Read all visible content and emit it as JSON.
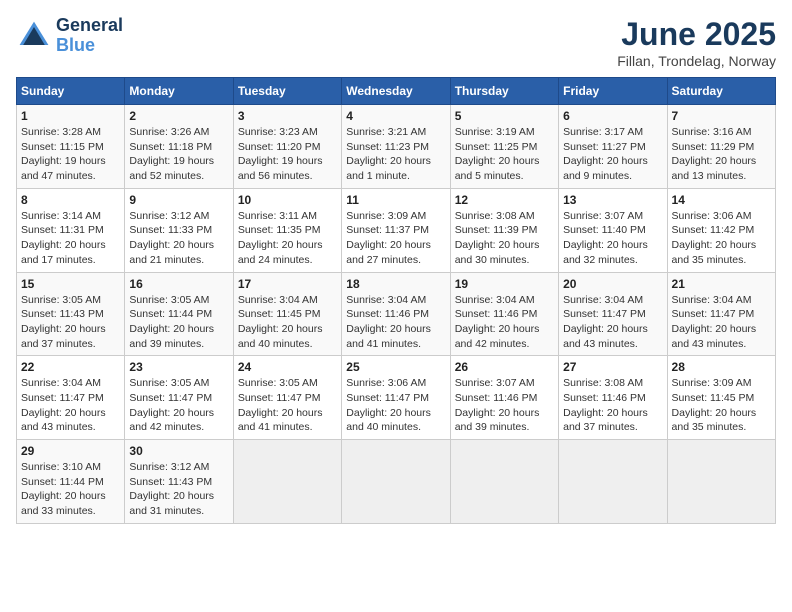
{
  "logo": {
    "line1": "General",
    "line2": "Blue"
  },
  "title": "June 2025",
  "subtitle": "Fillan, Trondelag, Norway",
  "days_header": [
    "Sunday",
    "Monday",
    "Tuesday",
    "Wednesday",
    "Thursday",
    "Friday",
    "Saturday"
  ],
  "weeks": [
    [
      {
        "day": 1,
        "info": "Sunrise: 3:28 AM\nSunset: 11:15 PM\nDaylight: 19 hours\nand 47 minutes."
      },
      {
        "day": 2,
        "info": "Sunrise: 3:26 AM\nSunset: 11:18 PM\nDaylight: 19 hours\nand 52 minutes."
      },
      {
        "day": 3,
        "info": "Sunrise: 3:23 AM\nSunset: 11:20 PM\nDaylight: 19 hours\nand 56 minutes."
      },
      {
        "day": 4,
        "info": "Sunrise: 3:21 AM\nSunset: 11:23 PM\nDaylight: 20 hours\nand 1 minute."
      },
      {
        "day": 5,
        "info": "Sunrise: 3:19 AM\nSunset: 11:25 PM\nDaylight: 20 hours\nand 5 minutes."
      },
      {
        "day": 6,
        "info": "Sunrise: 3:17 AM\nSunset: 11:27 PM\nDaylight: 20 hours\nand 9 minutes."
      },
      {
        "day": 7,
        "info": "Sunrise: 3:16 AM\nSunset: 11:29 PM\nDaylight: 20 hours\nand 13 minutes."
      }
    ],
    [
      {
        "day": 8,
        "info": "Sunrise: 3:14 AM\nSunset: 11:31 PM\nDaylight: 20 hours\nand 17 minutes."
      },
      {
        "day": 9,
        "info": "Sunrise: 3:12 AM\nSunset: 11:33 PM\nDaylight: 20 hours\nand 21 minutes."
      },
      {
        "day": 10,
        "info": "Sunrise: 3:11 AM\nSunset: 11:35 PM\nDaylight: 20 hours\nand 24 minutes."
      },
      {
        "day": 11,
        "info": "Sunrise: 3:09 AM\nSunset: 11:37 PM\nDaylight: 20 hours\nand 27 minutes."
      },
      {
        "day": 12,
        "info": "Sunrise: 3:08 AM\nSunset: 11:39 PM\nDaylight: 20 hours\nand 30 minutes."
      },
      {
        "day": 13,
        "info": "Sunrise: 3:07 AM\nSunset: 11:40 PM\nDaylight: 20 hours\nand 32 minutes."
      },
      {
        "day": 14,
        "info": "Sunrise: 3:06 AM\nSunset: 11:42 PM\nDaylight: 20 hours\nand 35 minutes."
      }
    ],
    [
      {
        "day": 15,
        "info": "Sunrise: 3:05 AM\nSunset: 11:43 PM\nDaylight: 20 hours\nand 37 minutes."
      },
      {
        "day": 16,
        "info": "Sunrise: 3:05 AM\nSunset: 11:44 PM\nDaylight: 20 hours\nand 39 minutes."
      },
      {
        "day": 17,
        "info": "Sunrise: 3:04 AM\nSunset: 11:45 PM\nDaylight: 20 hours\nand 40 minutes."
      },
      {
        "day": 18,
        "info": "Sunrise: 3:04 AM\nSunset: 11:46 PM\nDaylight: 20 hours\nand 41 minutes."
      },
      {
        "day": 19,
        "info": "Sunrise: 3:04 AM\nSunset: 11:46 PM\nDaylight: 20 hours\nand 42 minutes."
      },
      {
        "day": 20,
        "info": "Sunrise: 3:04 AM\nSunset: 11:47 PM\nDaylight: 20 hours\nand 43 minutes."
      },
      {
        "day": 21,
        "info": "Sunrise: 3:04 AM\nSunset: 11:47 PM\nDaylight: 20 hours\nand 43 minutes."
      }
    ],
    [
      {
        "day": 22,
        "info": "Sunrise: 3:04 AM\nSunset: 11:47 PM\nDaylight: 20 hours\nand 43 minutes."
      },
      {
        "day": 23,
        "info": "Sunrise: 3:05 AM\nSunset: 11:47 PM\nDaylight: 20 hours\nand 42 minutes."
      },
      {
        "day": 24,
        "info": "Sunrise: 3:05 AM\nSunset: 11:47 PM\nDaylight: 20 hours\nand 41 minutes."
      },
      {
        "day": 25,
        "info": "Sunrise: 3:06 AM\nSunset: 11:47 PM\nDaylight: 20 hours\nand 40 minutes."
      },
      {
        "day": 26,
        "info": "Sunrise: 3:07 AM\nSunset: 11:46 PM\nDaylight: 20 hours\nand 39 minutes."
      },
      {
        "day": 27,
        "info": "Sunrise: 3:08 AM\nSunset: 11:46 PM\nDaylight: 20 hours\nand 37 minutes."
      },
      {
        "day": 28,
        "info": "Sunrise: 3:09 AM\nSunset: 11:45 PM\nDaylight: 20 hours\nand 35 minutes."
      }
    ],
    [
      {
        "day": 29,
        "info": "Sunrise: 3:10 AM\nSunset: 11:44 PM\nDaylight: 20 hours\nand 33 minutes."
      },
      {
        "day": 30,
        "info": "Sunrise: 3:12 AM\nSunset: 11:43 PM\nDaylight: 20 hours\nand 31 minutes."
      },
      null,
      null,
      null,
      null,
      null
    ]
  ]
}
